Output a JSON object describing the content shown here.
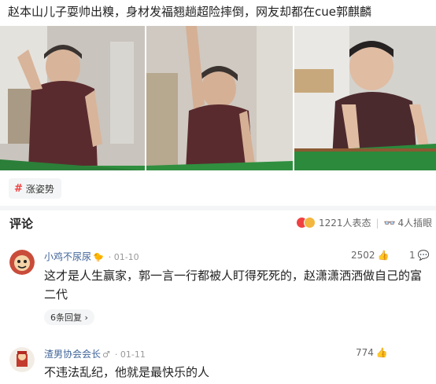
{
  "article": {
    "title": "赵本山儿子耍帅出糗，身材发福翘趟超险摔倒，网友却都在cue郭麒麟"
  },
  "tag": {
    "label": "涨姿势"
  },
  "comments_header": {
    "title": "评论",
    "reactions": "1221人表态",
    "watchers": "4人插眼",
    "glasses_icon": "👓"
  },
  "comments": [
    {
      "user": "小鸡不尿尿",
      "badge": "🐤",
      "time": "· 01-10",
      "likes": "2502",
      "reply_count": "1",
      "text": "这才是人生赢家，郭一言一行都被人盯得死死的，赵潇潇洒洒做自己的富二代",
      "replies": "6条回复 ›"
    },
    {
      "user": "渣男协会会长",
      "badge": "♂",
      "time": "· 01-11",
      "likes": "774",
      "text": "不违法乱纪，他就是最快乐的人"
    }
  ],
  "icons": {
    "thumb": "👍",
    "reply": "💬"
  }
}
